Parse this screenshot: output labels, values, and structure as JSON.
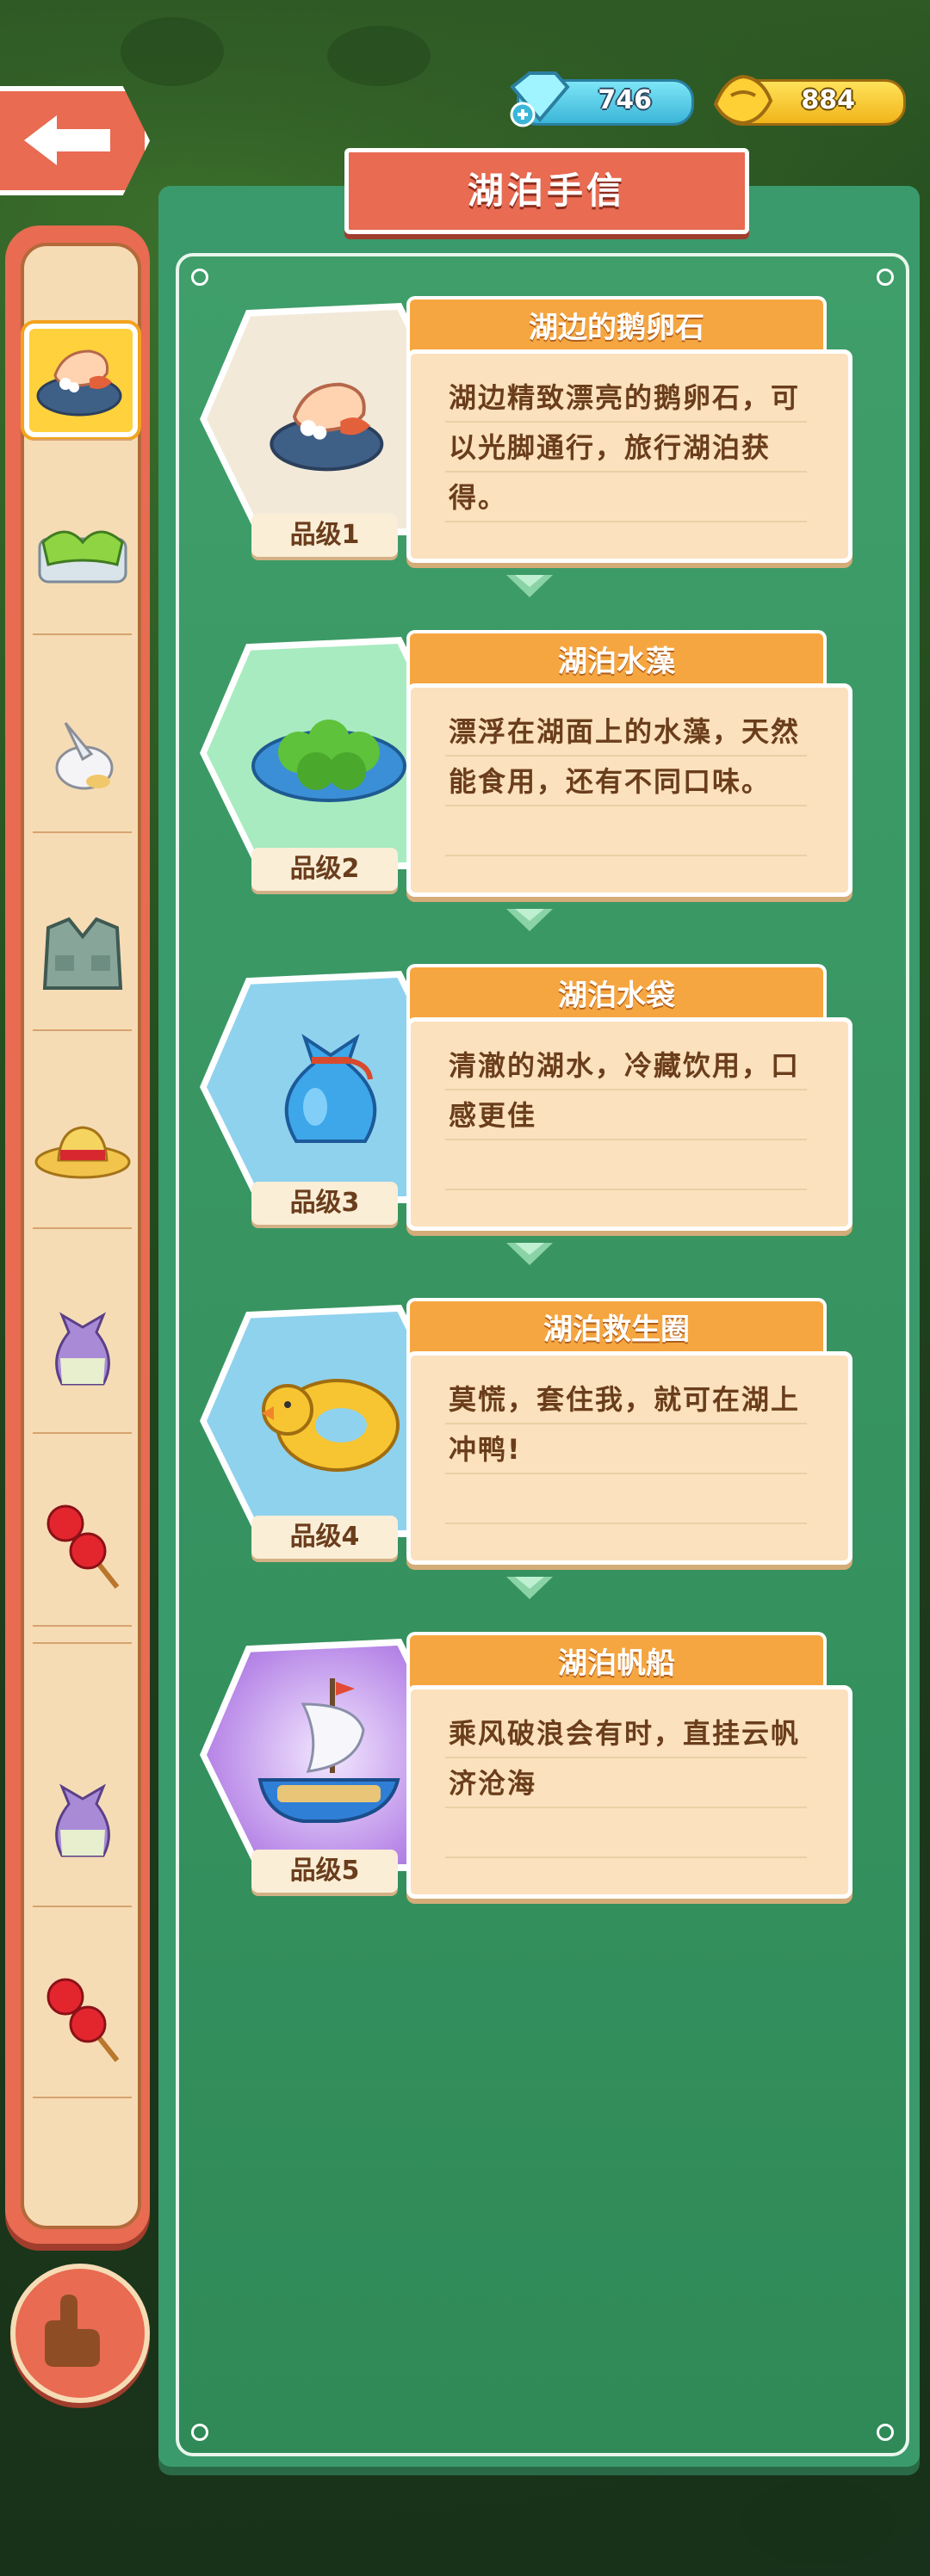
{
  "currency": {
    "gems": "746",
    "gold": "884"
  },
  "title": "湖泊手信",
  "colors": {
    "panel": "#3a9a6b",
    "accent": "#e86b52",
    "name_bar": "#f6a640",
    "desc_bg": "#fbe1bd",
    "text": "#6a3d1c"
  },
  "sidebar": {
    "items": [
      {
        "icon": "pebble-icon",
        "active": true
      },
      {
        "icon": "seaweed-icon",
        "active": false
      },
      {
        "icon": "water-bag-icon",
        "active": false
      },
      {
        "icon": "vest-icon",
        "active": false
      },
      {
        "icon": "straw-hat-icon",
        "active": false
      },
      {
        "icon": "pouch-icon",
        "active": false
      },
      {
        "icon": "candied-haws-icon",
        "active": false
      },
      {
        "icon": "pouch-icon",
        "active": false
      },
      {
        "icon": "candied-haws-icon",
        "active": false
      }
    ]
  },
  "items": [
    {
      "name": "湖边的鹅卵石",
      "grade": "品级1",
      "desc": "湖边精致漂亮的鹅卵石，可以光脚通行，旅行湖泊获得。",
      "icon": "pebble-icon"
    },
    {
      "name": "湖泊水藻",
      "grade": "品级2",
      "desc": "漂浮在湖面上的水藻，天然能食用，还有不同口味。",
      "icon": "seaweed-icon"
    },
    {
      "name": "湖泊水袋",
      "grade": "品级3",
      "desc": "清澈的湖水，冷藏饮用，口感更佳",
      "icon": "water-bag-icon"
    },
    {
      "name": "湖泊救生圈",
      "grade": "品级4",
      "desc": "莫慌，套住我，就可在湖上冲鸭!",
      "icon": "duck-ring-icon"
    },
    {
      "name": "湖泊帆船",
      "grade": "品级5",
      "desc": "乘风破浪会有时，直挂云帆济沧海",
      "icon": "sailboat-icon"
    }
  ]
}
